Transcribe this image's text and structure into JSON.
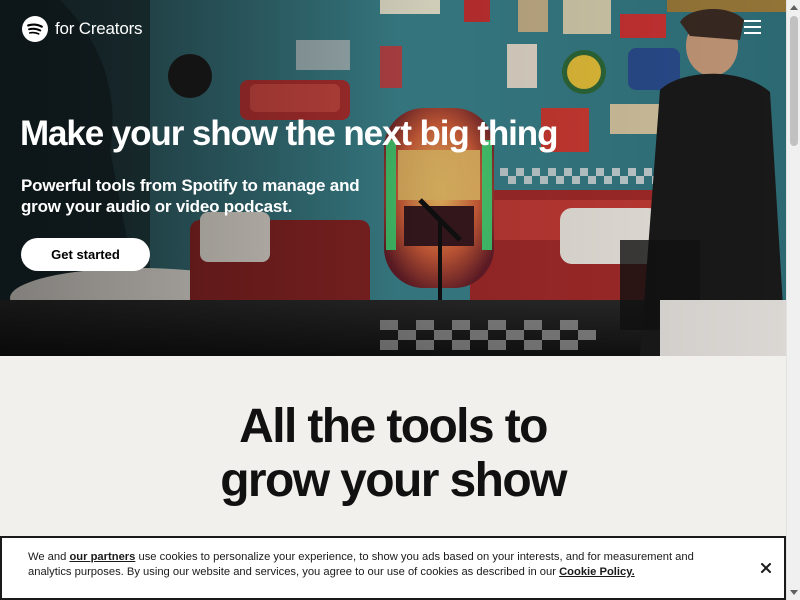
{
  "brand": {
    "name": "for Creators",
    "icon": "spotify-logo-icon"
  },
  "nav": {
    "menu_icon": "hamburger-menu-icon"
  },
  "hero": {
    "title": "Make your show the next big thing",
    "subtitle": "Powerful tools from Spotify to manage and grow your audio or video podcast.",
    "cta_label": "Get started",
    "image": "retro-diner-podcast-studio-photo"
  },
  "section": {
    "title_line1": "All the tools to",
    "title_line2": "grow your show"
  },
  "cookie_banner": {
    "text_before_link": "We and ",
    "partners_link": "our partners",
    "text_middle": " use cookies to personalize your experience, to show you ads based on your interests, and for measurement and analytics purposes. By using our website and services, you agree to our use of cookies as described in our ",
    "policy_link": "Cookie Policy.",
    "close_icon": "close-icon"
  },
  "colors": {
    "hero_bg": "#20363c",
    "section_bg": "#f2f0ec",
    "text_dark": "#111111",
    "cta_bg": "#ffffff"
  }
}
